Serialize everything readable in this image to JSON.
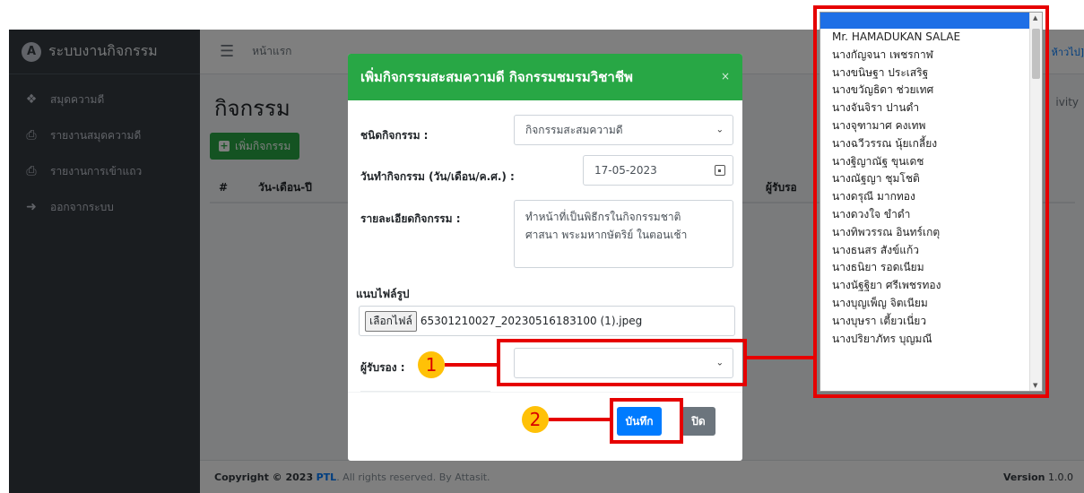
{
  "app": {
    "brand": "ระบบงานกิจกรรม",
    "logo_letter": "A"
  },
  "sidebar": {
    "items": [
      {
        "label": "สมุดความดี",
        "icon": "home-icon"
      },
      {
        "label": "รายงานสมุดความดี",
        "icon": "print-icon"
      },
      {
        "label": "รายงานการเข้าแถว",
        "icon": "print-icon"
      },
      {
        "label": "ออกจากระบบ",
        "icon": "logout-icon"
      }
    ]
  },
  "topbar": {
    "home_label": "หน้าแรก",
    "right_text": "ห้าวไป]"
  },
  "content": {
    "title": "กิจกรรม",
    "breadcrumb_right": "ivity",
    "add_button": "เพิ่มกิจกรรม",
    "table_headers": [
      "#",
      "วัน-เดือน-ปี",
      "ผู้รับรอ"
    ]
  },
  "footer": {
    "copyright_prefix": "Copyright © 2023",
    "brand": "PTL",
    "suffix": ". All rights reserved. By Attasit.",
    "version_label": "Version",
    "version_number": "1.0.0"
  },
  "modal": {
    "title": "เพิ่มกิจกรรมสะสมความดี กิจกรรมชมรมวิชาชีพ",
    "close_symbol": "×",
    "activity_type_label": "ชนิดกิจกรรม :",
    "activity_type_value": "กิจกรรมสะสมความดี",
    "date_label": "วันทำกิจกรรม (วัน/เดือน/ค.ศ.) :",
    "date_value": "17-05-2023",
    "details_label": "รายละเอียดกิจกรรม :",
    "details_line1": "ทำหน้าที่เป็นพิธีกรในกิจกรรมชาติ",
    "details_line2": "ศาสนา พระมหากษัตริย์ ในตอนเช้า",
    "image_label": "แนบไฟล์รูป",
    "file_button": "เลือกไฟล์",
    "file_name": "65301210027_20230516183100 (1).jpeg",
    "approver_label": "ผู้รับรอง :",
    "approver_value": "",
    "save_button": "บันทึก",
    "close_button": "ปิด"
  },
  "annotations": {
    "badge1": "1",
    "badge2": "2",
    "color": "#e60000"
  },
  "dropdown": {
    "options": [
      "Mr. HAMADUKAN SALAE",
      "นางกัญจนา เพชรกาฬ",
      "นางขนิษฐา ประเสริฐ",
      "นางขวัญธิดา ช่วยเทศ",
      "นางจันจิรา ปานดำ",
      "นางจุฑามาศ คงเทพ",
      "นางฉวีวรรณ นุ้ยเกลี้ยง",
      "นางฐิญาณัฐ ขุนเดช",
      "นางณัฐญา ชุมโชติ",
      "นางดรุณี มากทอง",
      "นางดวงใจ ขำดำ",
      "นางทิพวรรณ อินทร์เกตุ",
      "นางธนสร สังข์แก้ว",
      "นางธนิยา รอดเนียม",
      "นางนัฐฐิยา ศรีเพชรทอง",
      "นางบุญเพ็ญ จิตเนียม",
      "นางบุษรา เตี้ยวเนี่ยว",
      "นางปริยาภัทร บุญมณี"
    ]
  }
}
